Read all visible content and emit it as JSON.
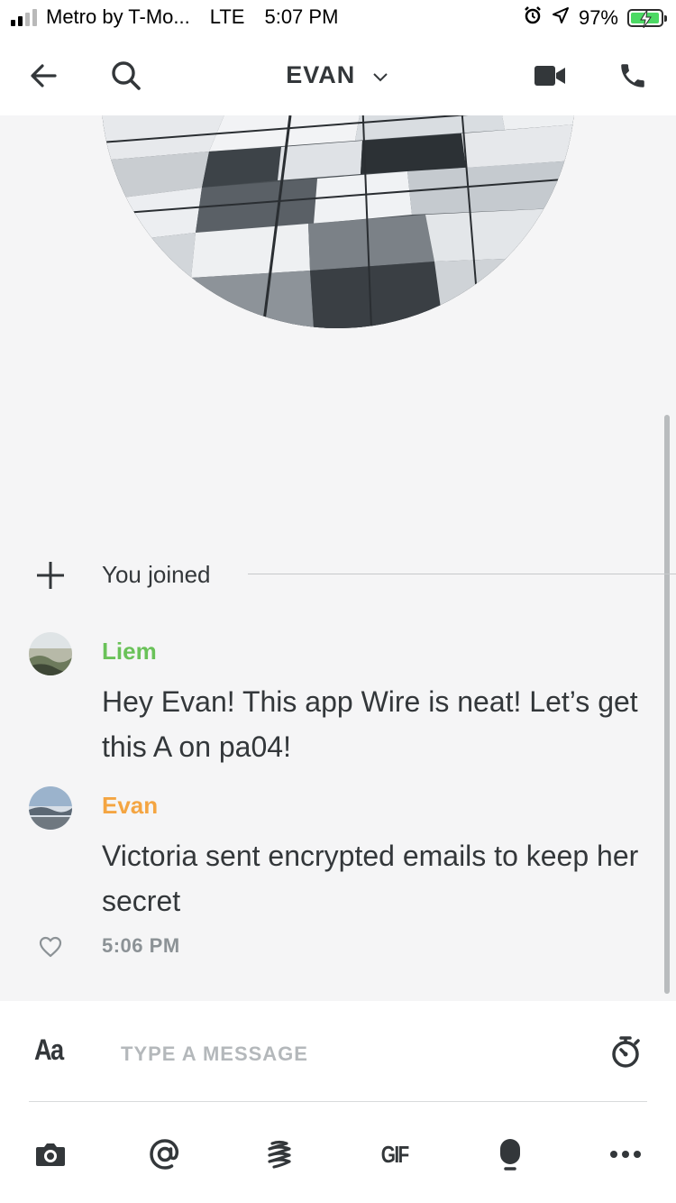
{
  "status_bar": {
    "carrier": "Metro by T-Mo...",
    "network": "LTE",
    "time": "5:07 PM",
    "battery": "97%",
    "icons": [
      "signal-icon",
      "alarm-icon",
      "location-icon",
      "battery-charging-icon"
    ]
  },
  "header": {
    "title": "EVAN",
    "icons": [
      "back-arrow-icon",
      "search-icon",
      "chevron-down-icon",
      "video-call-icon",
      "phone-icon"
    ]
  },
  "system_message": {
    "text": "You joined",
    "icon": "plus-icon"
  },
  "messages": [
    {
      "sender": "Liem",
      "sender_color": "#6ac259",
      "text": "Hey Evan! This app Wire is neat! Let’s get this A on pa04!"
    },
    {
      "sender": "Evan",
      "sender_color": "#f4a542",
      "text": "Victoria sent encrypted emails to keep her secret"
    }
  ],
  "last_message_meta": {
    "time": "5:06 PM",
    "icon": "heart-icon"
  },
  "composer": {
    "format_label": "Aa",
    "placeholder": "TYPE A MESSAGE",
    "timer_icon": "timer-icon"
  },
  "toolbar": {
    "gif_label": "GIF",
    "icons": [
      "camera-icon",
      "mention-icon",
      "sketch-icon",
      "gif-icon",
      "microphone-icon",
      "more-icon"
    ]
  },
  "colors": {
    "background": "#f5f5f6",
    "text": "#33373a",
    "timestamp": "#8c9296",
    "battery_fill": "#4cd964"
  }
}
